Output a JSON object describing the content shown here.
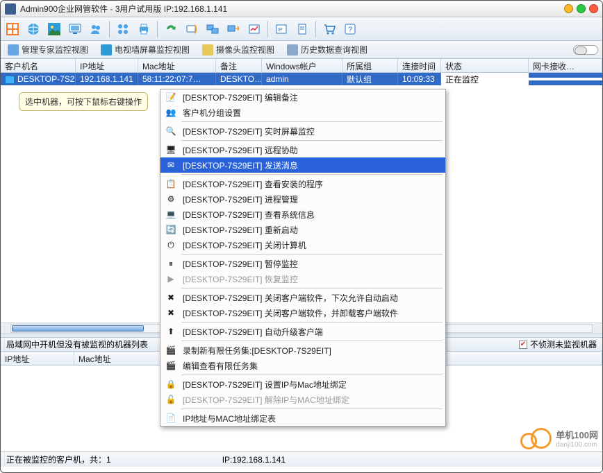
{
  "title": "Admin900企业网管软件 - 3用户试用版 IP:192.168.1.141",
  "viewtabs": {
    "expert": "管理专家监控视图",
    "wall": "电视墙屏幕监控视图",
    "camera": "摄像头监控视图",
    "history": "历史数据查询视图"
  },
  "cols": {
    "host": "客户机名",
    "ip": "IP地址",
    "mac": "Mac地址",
    "note": "备注",
    "user": "Windows帐户",
    "group": "所属组",
    "time": "连接时间",
    "status": "状态",
    "nic": "网卡接收…"
  },
  "row": {
    "host": "DESKTOP-7S2…",
    "ip": "192.168.1.141",
    "mac": "58:11:22:07:7…",
    "note": "DESKTO…",
    "user": "admin",
    "group": "默认组",
    "time": "10:09:33",
    "status": "正在监控",
    "nic": ""
  },
  "tooltip": "选中机器，可按下鼠标右键操作",
  "pane2": {
    "title": "局域网中开机但没有被监视的机器列表",
    "checkbox": "不侦测未监视机器",
    "ip": "IP地址",
    "mac": "Mac地址"
  },
  "status": {
    "left": "正在被监控的客户机，共：1",
    "ip": "IP:192.168.1.141"
  },
  "logo": "单机100网",
  "logo_sub": "danji100.com",
  "ctx": {
    "t": "[DESKTOP-7S29EIT]",
    "items": [
      {
        "label": "编辑备注",
        "ico": "📝"
      },
      {
        "label_full": "客户机分组设置",
        "ico": "👥"
      },
      "sep",
      {
        "label": "实时屏幕监控",
        "ico": "🔍"
      },
      "sep",
      {
        "label": "远程协助",
        "ico": "🖥"
      },
      {
        "label": "发送消息",
        "ico": "✉",
        "hl": true
      },
      "sep",
      {
        "label": "查看安装的程序",
        "ico": "📋"
      },
      {
        "label": "进程管理",
        "ico": "⚙"
      },
      {
        "label": "查看系统信息",
        "ico": "💻"
      },
      {
        "label": "重新启动",
        "ico": "🔄"
      },
      {
        "label": "关闭计算机",
        "ico": "⏻"
      },
      "sep",
      {
        "label": "暂停监控",
        "ico": "⏸"
      },
      {
        "label": "恢复监控",
        "ico": "▶",
        "disabled": true
      },
      "sep",
      {
        "label": "关闭客户端软件，下次允许自动启动",
        "ico": "✖"
      },
      {
        "label": "关闭客户端软件，并卸载客户端软件",
        "ico": "✖"
      },
      "sep",
      {
        "label": "自动升级客户端",
        "ico": "⬆"
      },
      "sep",
      {
        "label_full": "录制新有限任务集:[DESKTOP-7S29EIT]",
        "ico": "🎬"
      },
      {
        "label_full": "编辑查看有限任务集",
        "ico": "🎬"
      },
      "sep",
      {
        "label": "设置IP与Mac地址绑定",
        "ico": "🔒"
      },
      {
        "label": "解除IP与MAC地址绑定",
        "ico": "🔓",
        "disabled": true
      },
      "sep",
      {
        "label_full": "IP地址与MAC地址绑定表",
        "ico": "📄"
      }
    ]
  }
}
